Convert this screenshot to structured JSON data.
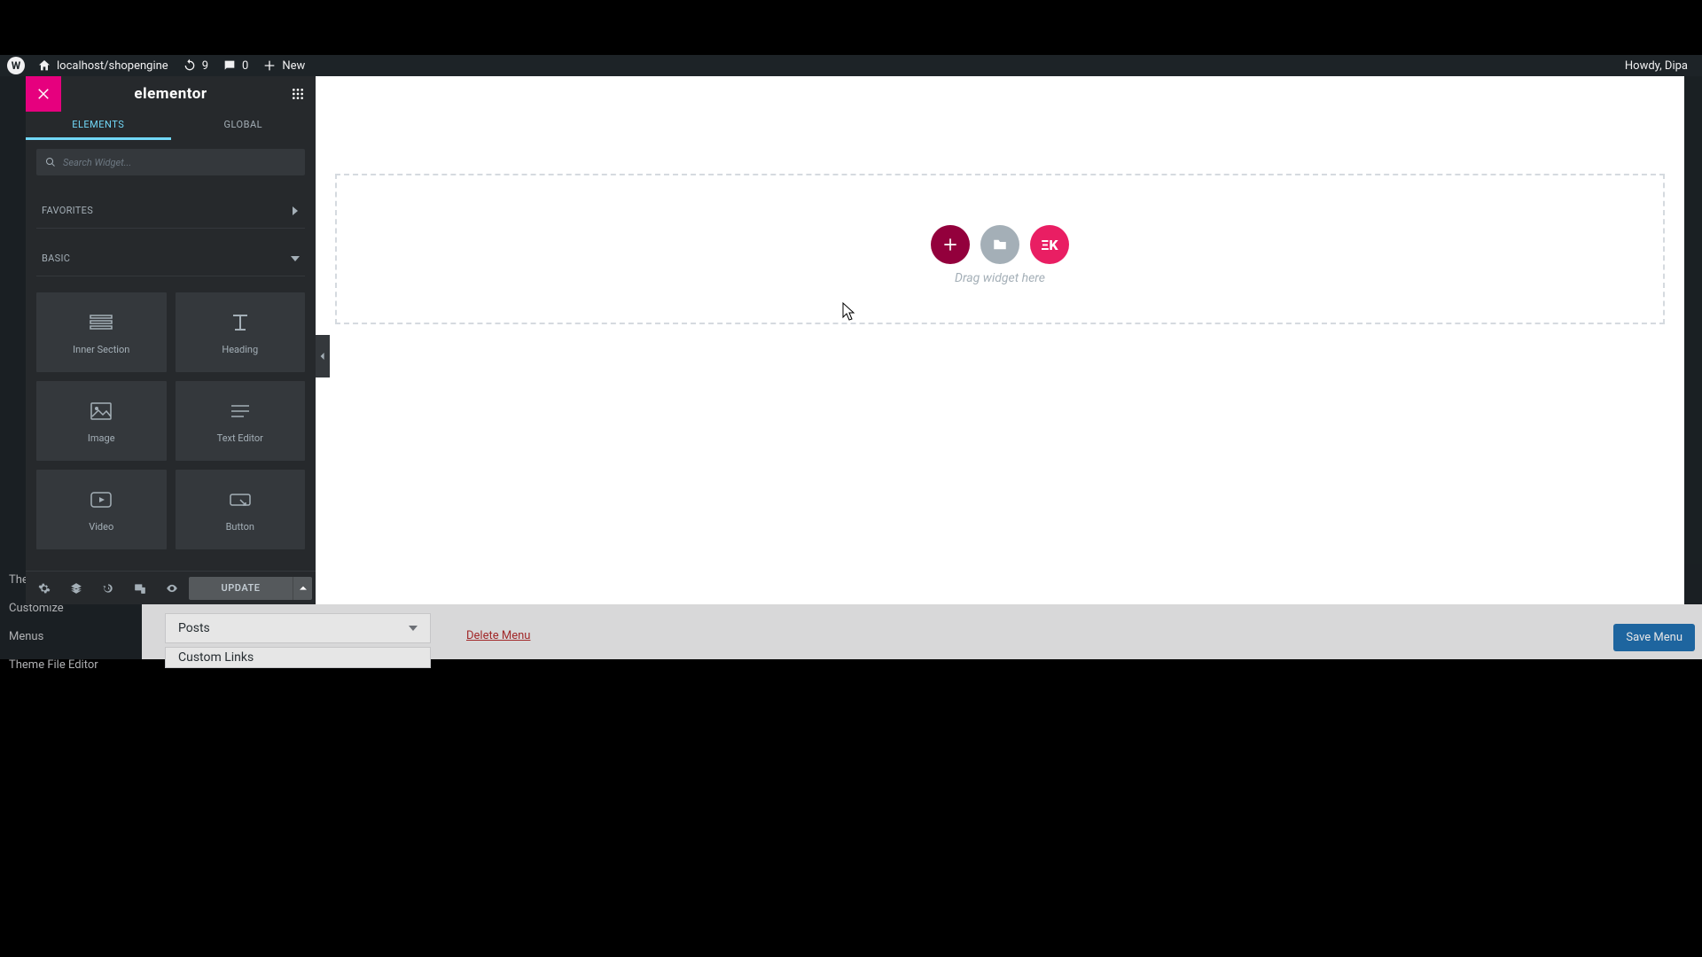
{
  "adminbar": {
    "site": "localhost/shopengine",
    "updates": "9",
    "comments": "0",
    "new": "New",
    "howdy": "Howdy, Dipa"
  },
  "panel": {
    "title": "elementor",
    "tabs": {
      "elements": "ELEMENTS",
      "global": "GLOBAL"
    },
    "search_placeholder": "Search Widget...",
    "categories": {
      "favorites": "FAVORITES",
      "basic": "BASIC"
    },
    "widgets": {
      "inner_section": "Inner Section",
      "heading": "Heading",
      "image": "Image",
      "text_editor": "Text Editor",
      "video": "Video",
      "button": "Button"
    },
    "footer": {
      "update": "UPDATE"
    }
  },
  "canvas": {
    "drag_text": "Drag widget here"
  },
  "wp": {
    "menu": {
      "theme_file_editor": "Theme File Editor",
      "menus": "Menus",
      "customize": "Customize",
      "themes": "Themes"
    },
    "posts_box": "Posts",
    "custom_links": "Custom Links",
    "delete": "Delete Menu",
    "save": "Save Menu"
  }
}
